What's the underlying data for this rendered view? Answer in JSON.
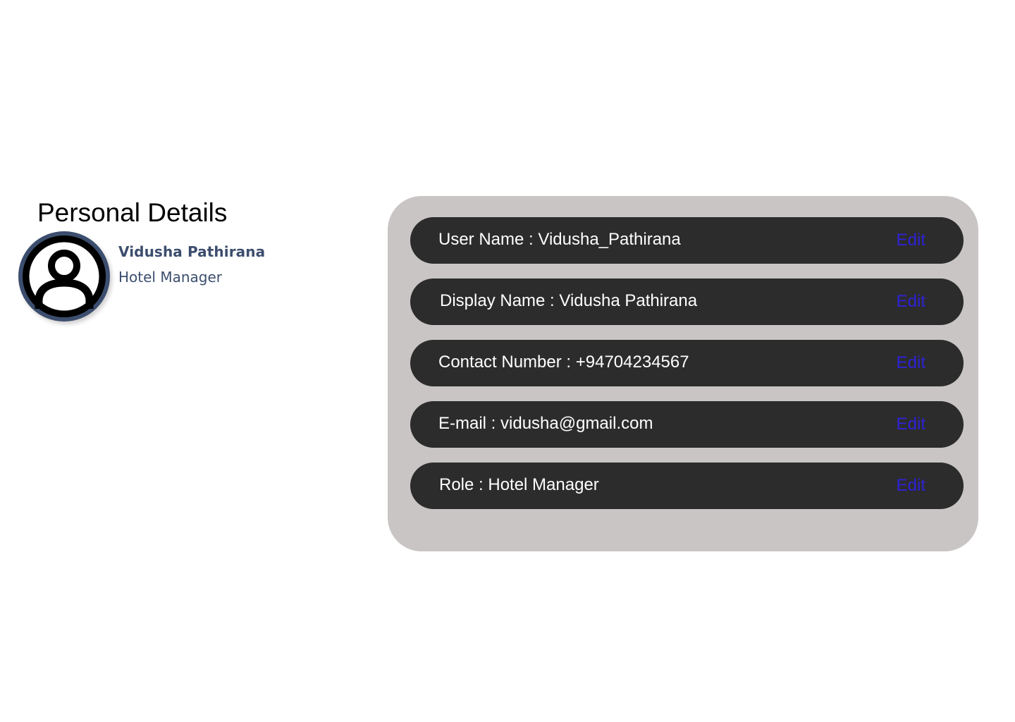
{
  "page": {
    "title": "Personal Details"
  },
  "profile": {
    "avatar_icon": "user-avatar-icon",
    "name": "Vidusha Pathirana",
    "role": "Hotel Manager",
    "accent_color": "#3c4e6e"
  },
  "details": {
    "card_color": "#c8c5c4",
    "row_color": "#2c2c2c",
    "edit_color": "#2e22d8",
    "rows": [
      {
        "text": "User Name : Vidusha_Pathirana",
        "edit_label": "Edit"
      },
      {
        "text": "Display Name : Vidusha Pathirana",
        "edit_label": "Edit"
      },
      {
        "text": "Contact Number : +94704234567",
        "edit_label": "Edit"
      },
      {
        "text": "E-mail : vidusha@gmail.com",
        "edit_label": "Edit"
      },
      {
        "text": "Role : Hotel Manager",
        "edit_label": "Edit"
      }
    ]
  }
}
